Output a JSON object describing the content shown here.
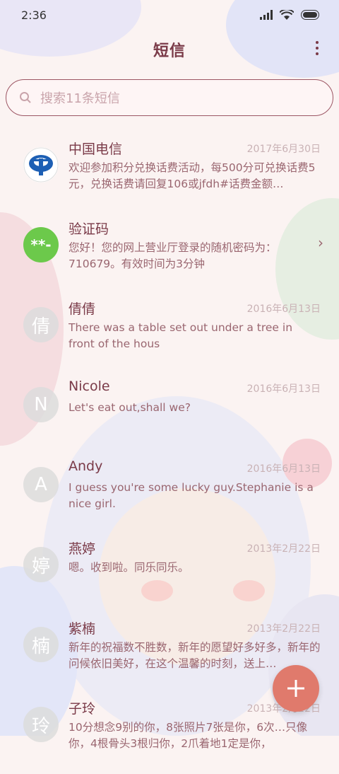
{
  "status": {
    "time": "2:36"
  },
  "header": {
    "title": "短信"
  },
  "search": {
    "placeholder": "搜索11条短信"
  },
  "conversations": [
    {
      "avatar": "",
      "avatar_icon": "china-telecom-logo-icon",
      "name": "中国电信",
      "date": "2017年6月30日",
      "snippet": "欢迎参加积分兑换话费活动，每500分可兑换话费5元，兑换话费请回复106或jfdh#话费金额…"
    },
    {
      "avatar": "**-",
      "avatar_icon": "verification-code-icon",
      "name": "验证码",
      "date": "",
      "snippet": "您好！您的网上营业厅登录的随机密码为：710679。有效时间为3分钟"
    },
    {
      "avatar": "倩",
      "name": "倩倩",
      "date": "2016年6月13日",
      "snippet": "There was a table set out under a tree in front of the hous"
    },
    {
      "avatar": "N",
      "name": "Nicole",
      "date": "2016年6月13日",
      "snippet": "Let's eat out,shall we?"
    },
    {
      "avatar": "A",
      "name": "Andy",
      "date": "2016年6月13日",
      "snippet": "I guess you're some lucky guy.Stephanie is a nice girl."
    },
    {
      "avatar": "婷",
      "name": "燕婷",
      "date": "2013年2月22日",
      "snippet": "嗯。收到啦。同乐同乐。"
    },
    {
      "avatar": "楠",
      "name": "紫楠",
      "date": "2013年2月22日",
      "snippet": "新年的祝福数不胜数，新年的愿望好多好多，新年的问候依旧美好，在这个温馨的时刻，送上…"
    },
    {
      "avatar": "玲",
      "name": "子玲",
      "date": "2013年2月22日",
      "snippet": "10分想念9别的你，8张照片7张是你，6次…只像你，4根骨头3根归你，2爪着地1定是你，"
    }
  ],
  "colors": {
    "accent": "#7a3a48",
    "fab": "#e07a6c",
    "verify_avatar": "#6cc94b",
    "telecom_blue": "#1d5fb4"
  }
}
